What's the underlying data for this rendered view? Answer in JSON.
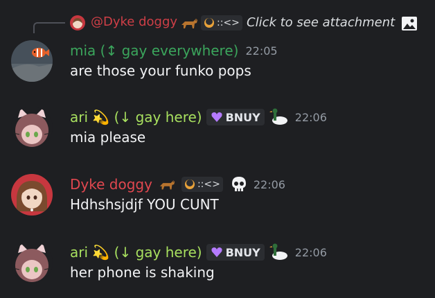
{
  "reply": {
    "username": "@Dyke doggy",
    "name_emoji": "dog-icon",
    "tag_text": "::<>",
    "preview": "Click to see attachment",
    "attachment_icon": "image-icon"
  },
  "messages": [
    {
      "username": "mia (↕ gay everywhere)",
      "name_color": "#3ba55c",
      "timestamp": "22:05",
      "text": "are those your funko pops",
      "avatar": "fish-avatar"
    },
    {
      "username": "ari 💫 (↓ gay here)",
      "name_color": "#a8e05f",
      "badge": "BNUY",
      "timestamp": "22:06",
      "text": "mia please",
      "avatar": "cat-girl-avatar"
    },
    {
      "username": "Dyke doggy",
      "name_color": "#e0474f",
      "tag_text": "::<>",
      "timestamp": "22:06",
      "text": "Hdhshsjdjf YOU CUNT",
      "avatar": "dog-girl-avatar"
    },
    {
      "username": "ari 💫 (↓ gay here)",
      "name_color": "#a8e05f",
      "badge": "BNUY",
      "timestamp": "22:06",
      "text": "her phone is shaking",
      "avatar": "cat-girl-avatar"
    }
  ]
}
